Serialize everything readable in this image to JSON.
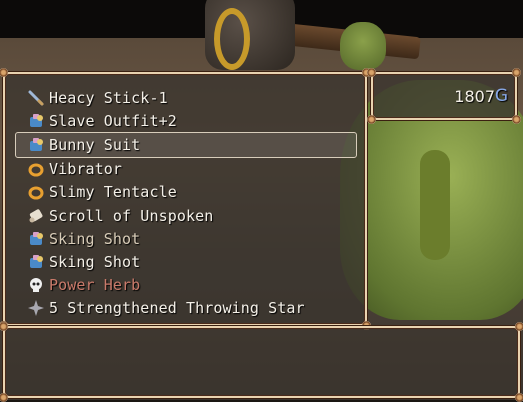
{
  "items": [
    {
      "name": "Heacy Stick-1",
      "icon": "stick-icon",
      "style": "normal"
    },
    {
      "name": "Slave Outfit+2",
      "icon": "outfit-icon",
      "style": "normal"
    },
    {
      "name": "Bunny Suit",
      "icon": "outfit-icon",
      "style": "selected"
    },
    {
      "name": "Vibrator",
      "icon": "ring-icon",
      "style": "normal"
    },
    {
      "name": "Slimy Tentacle",
      "icon": "ring-icon",
      "style": "normal"
    },
    {
      "name": "Scroll of Unspoken",
      "icon": "scroll-icon",
      "style": "normal"
    },
    {
      "name": "Sking Shot",
      "icon": "outfit-icon",
      "style": "dim"
    },
    {
      "name": "Sking Shot",
      "icon": "outfit-icon",
      "style": "normal"
    },
    {
      "name": "Power Herb",
      "icon": "skull-icon",
      "style": "red"
    },
    {
      "name": "5 Strengthened Throwing Star",
      "icon": "star-icon",
      "style": "normal"
    }
  ],
  "gold": {
    "amount": "1807",
    "unit": "G"
  },
  "help": {
    "text": ""
  },
  "colors": {
    "window_border": "#e9d3b0",
    "text": "#f4f0e8",
    "gold_unit": "#88a8e8",
    "item_red": "#c97a6a"
  }
}
